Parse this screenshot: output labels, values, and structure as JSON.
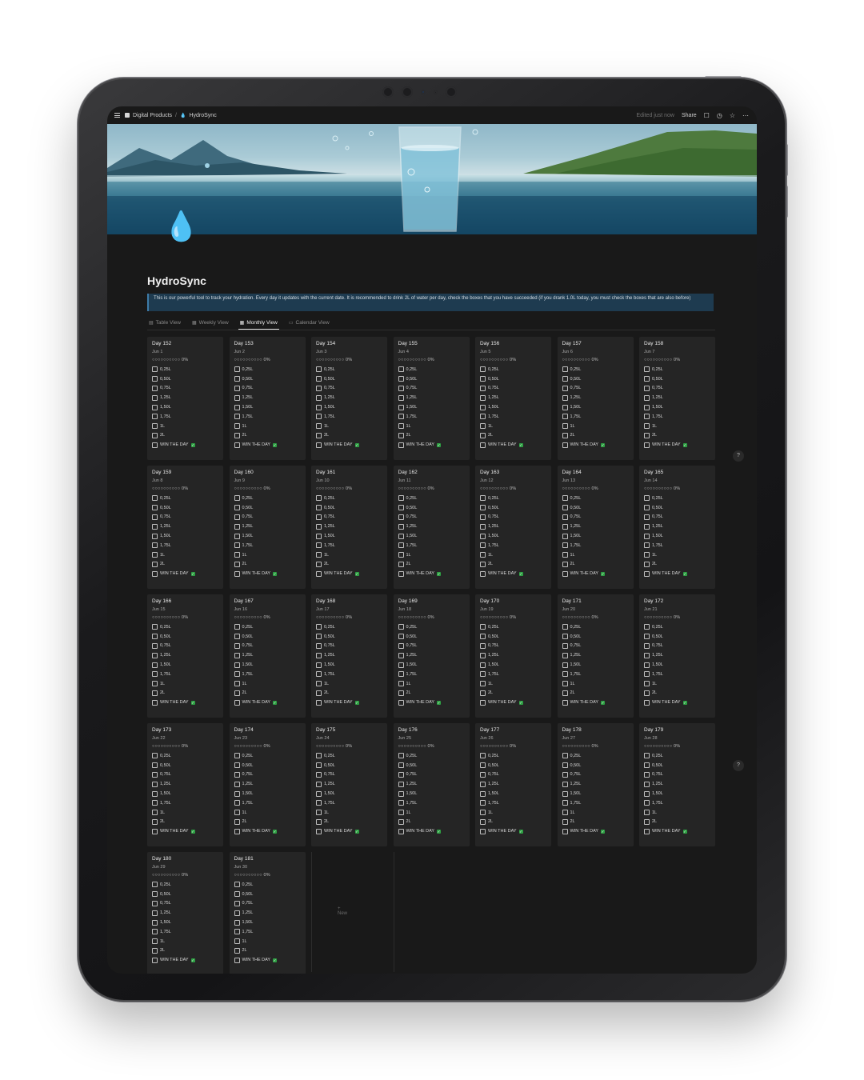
{
  "topbar": {
    "breadcrumb_parent": "Digital Products",
    "breadcrumb_sep": "/",
    "breadcrumb_current": "HydroSync",
    "edited": "Edited just now",
    "share": "Share"
  },
  "page": {
    "title": "HydroSync",
    "icon": "water-drop-icon",
    "callout": "This is our powerful tool to track your hydration. Every day it updates with the current date. It is recommended to drink 2L of water per day, check the boxes that you have succeeded (if you drank 1.0L today, you must check the boxes that are also before)"
  },
  "tabs": [
    {
      "label": "Table View",
      "icon": "table-icon",
      "active": false
    },
    {
      "label": "Weekly View",
      "icon": "grid-icon",
      "active": false
    },
    {
      "label": "Monthly View",
      "icon": "calendar-grid-icon",
      "active": true
    },
    {
      "label": "Calendar View",
      "icon": "calendar-icon",
      "active": false
    }
  ],
  "checklist": [
    "0,25L",
    "0,50L",
    "0,75L",
    "1,25L",
    "1,50L",
    "1,75L",
    "1L",
    "2L"
  ],
  "win_label": "WIN THE DAY",
  "progress_label": "0%",
  "cards": [
    {
      "day": "Day 152",
      "date": "Jun 1"
    },
    {
      "day": "Day 153",
      "date": "Jun 2"
    },
    {
      "day": "Day 154",
      "date": "Jun 3"
    },
    {
      "day": "Day 155",
      "date": "Jun 4"
    },
    {
      "day": "Day 156",
      "date": "Jun 5"
    },
    {
      "day": "Day 157",
      "date": "Jun 6"
    },
    {
      "day": "Day 158",
      "date": "Jun 7"
    },
    {
      "day": "Day 159",
      "date": "Jun 8"
    },
    {
      "day": "Day 160",
      "date": "Jun 9"
    },
    {
      "day": "Day 161",
      "date": "Jun 10"
    },
    {
      "day": "Day 162",
      "date": "Jun 11"
    },
    {
      "day": "Day 163",
      "date": "Jun 12"
    },
    {
      "day": "Day 164",
      "date": "Jun 13"
    },
    {
      "day": "Day 165",
      "date": "Jun 14"
    },
    {
      "day": "Day 166",
      "date": "Jun 15"
    },
    {
      "day": "Day 167",
      "date": "Jun 16"
    },
    {
      "day": "Day 168",
      "date": "Jun 17"
    },
    {
      "day": "Day 169",
      "date": "Jun 18"
    },
    {
      "day": "Day 170",
      "date": "Jun 19"
    },
    {
      "day": "Day 171",
      "date": "Jun 20"
    },
    {
      "day": "Day 172",
      "date": "Jun 21"
    },
    {
      "day": "Day 173",
      "date": "Jun 22"
    },
    {
      "day": "Day 174",
      "date": "Jun 23"
    },
    {
      "day": "Day 175",
      "date": "Jun 24"
    },
    {
      "day": "Day 176",
      "date": "Jun 25"
    },
    {
      "day": "Day 177",
      "date": "Jun 26"
    },
    {
      "day": "Day 178",
      "date": "Jun 27"
    },
    {
      "day": "Day 179",
      "date": "Jun 28"
    },
    {
      "day": "Day 180",
      "date": "Jun 29"
    },
    {
      "day": "Day 181",
      "date": "Jun 30"
    }
  ],
  "new_label": "+ New",
  "help_label": "?"
}
